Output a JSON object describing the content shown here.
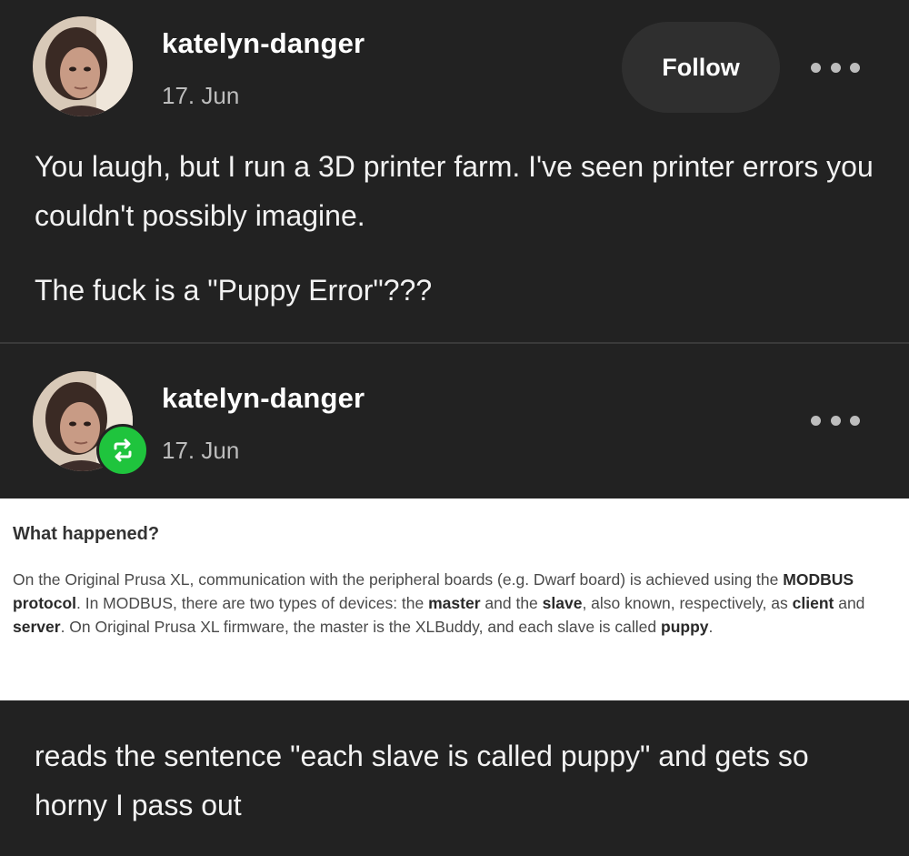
{
  "post1": {
    "username": "katelyn-danger",
    "date": "17. Jun",
    "follow_label": "Follow",
    "paragraph1": "You laugh, but I run a 3D printer farm. I've seen printer errors you couldn't possibly imagine.",
    "paragraph2": "The fuck is a \"Puppy Error\"???"
  },
  "post2": {
    "username": "katelyn-danger",
    "date": "17. Jun",
    "reblog_icon": "reblog-icon",
    "reblog_color": "#1fc43d"
  },
  "screenshot": {
    "heading": "What happened?",
    "t1": "On the Original Prusa XL, communication with the peripheral boards (e.g. Dwarf board) is achieved using the ",
    "b1": "MODBUS protocol",
    "t2": ". In MODBUS, there are two types of devices: the ",
    "b2": "master",
    "t3": " and the ",
    "b3": "slave",
    "t4": ", also known, respectively, as ",
    "b4": "client",
    "t5": " and ",
    "b5": "server",
    "t6": ". On Original Prusa XL firmware, the master is the XLBuddy, and each slave is called ",
    "b6": "puppy",
    "t7": "."
  },
  "post3": {
    "paragraph": "reads the sentence \"each slave is called puppy\" and gets so horny I pass out"
  },
  "colors": {
    "background": "#222222",
    "text": "#ffffff",
    "muted": "#bdbdbd",
    "follow_bg": "#2f2f2f"
  }
}
